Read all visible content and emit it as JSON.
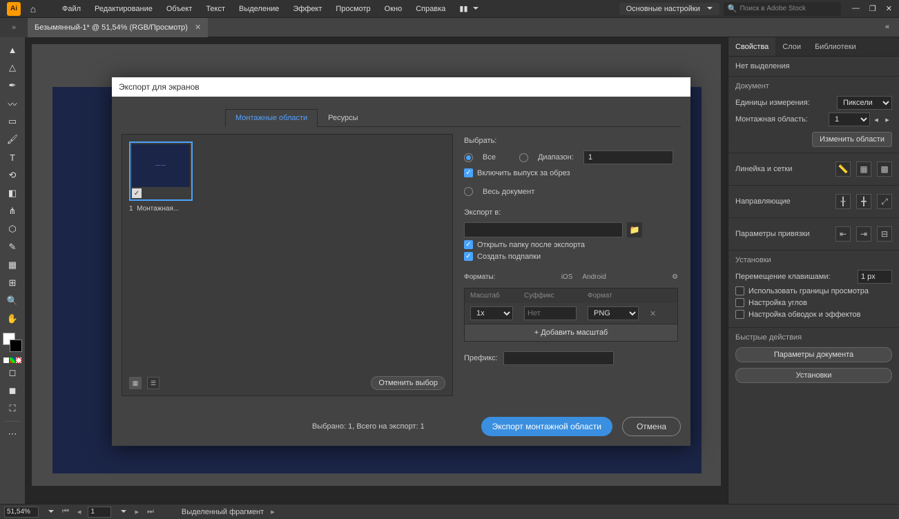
{
  "menubar": {
    "items": [
      "Файл",
      "Редактирование",
      "Объект",
      "Текст",
      "Выделение",
      "Эффект",
      "Просмотр",
      "Окно",
      "Справка"
    ],
    "workspace": "Основные настройки",
    "search_placeholder": "Поиск в Adobe Stock"
  },
  "document_tab": {
    "title": "Безымянный-1* @ 51,54% (RGB/Просмотр)"
  },
  "right_panel": {
    "tabs": [
      "Свойства",
      "Слои",
      "Библиотеки"
    ],
    "no_selection": "Нет выделения",
    "doc_heading": "Документ",
    "units_label": "Единицы измерения:",
    "units_value": "Пиксели",
    "artboard_label": "Монтажная область:",
    "artboard_value": "1",
    "edit_artboards": "Изменить области",
    "rulers_heading": "Линейка и сетки",
    "guides_heading": "Направляющие",
    "snap_heading": "Параметры привязки",
    "settings_heading": "Установки",
    "key_move_label": "Перемещение клавишами:",
    "key_move_value": "1 px",
    "use_preview_bounds": "Использовать границы просмотра",
    "scale_corners": "Настройка углов",
    "scale_strokes": "Настройка обводок и эффектов",
    "quick_actions": "Быстрые действия",
    "doc_setup_btn": "Параметры документа",
    "prefs_btn": "Установки"
  },
  "dialog": {
    "title": "Экспорт для экранов",
    "tab_artboards": "Монтажные области",
    "tab_assets": "Ресурсы",
    "thumb_index": "1",
    "thumb_label": "Монтажная...",
    "clear_selection": "Отменить выбор",
    "select_heading": "Выбрать:",
    "radio_all": "Все",
    "radio_range": "Диапазон:",
    "range_value": "1",
    "include_bleed": "Включить выпуск за обрез",
    "radio_full_doc": "Весь документ",
    "export_to_heading": "Экспорт в:",
    "open_after": "Открыть папку после экспорта",
    "create_subfolders": "Создать подпапки",
    "formats_heading": "Форматы:",
    "platform_ios": "iOS",
    "platform_android": "Android",
    "col_scale": "Масштаб",
    "col_suffix": "Суффикс",
    "col_format": "Формат",
    "row_scale": "1x",
    "row_suffix_placeholder": "Нет",
    "row_format": "PNG",
    "add_scale": "+ Добавить масштаб",
    "prefix_label": "Префикс:",
    "summary": "Выбрано: 1, Всего на экспорт: 1",
    "export_btn": "Экспорт монтажной области",
    "cancel_btn": "Отмена"
  },
  "status": {
    "zoom": "51,54%",
    "page": "1",
    "fragment": "Выделенный фрагмент"
  }
}
